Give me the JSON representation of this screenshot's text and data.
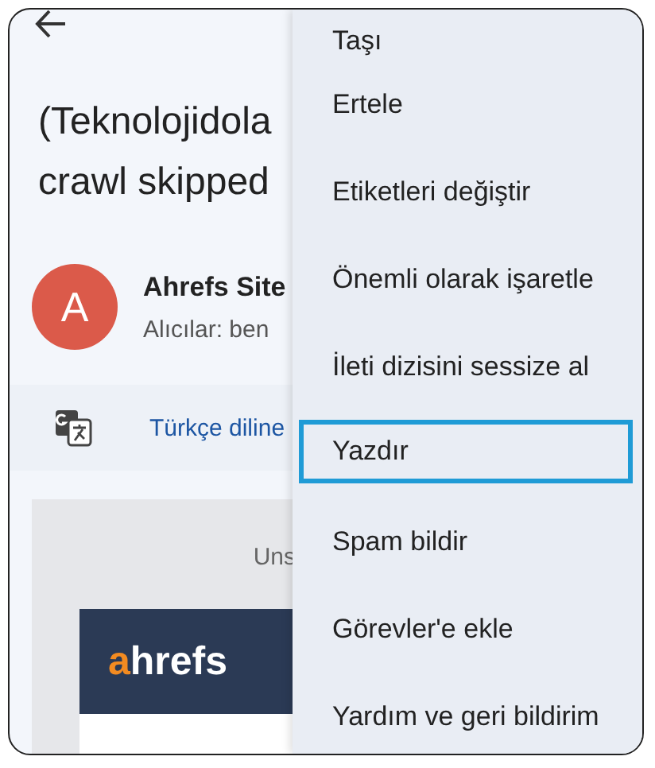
{
  "email": {
    "title_lines": [
      "(Teknolojidola",
      "crawl skipped"
    ],
    "sender": {
      "initial": "A",
      "name": "Ahrefs Site",
      "recipients": "Alıcılar: ben"
    },
    "translate": {
      "label": "Türkçe diline"
    },
    "body": {
      "top_text": "Uns",
      "logo": "ahrefs"
    }
  },
  "menu": {
    "items": [
      {
        "label": "Taşı",
        "selected": false
      },
      {
        "label": "Ertele",
        "selected": false
      },
      {
        "label": "Etiketleri değiştir",
        "selected": false
      },
      {
        "label": "Önemli olarak işaretle",
        "selected": false
      },
      {
        "label": "İleti dizisini sessize al",
        "selected": false
      },
      {
        "label": "Yazdır",
        "selected": true
      },
      {
        "label": "Spam bildir",
        "selected": false
      },
      {
        "label": "Görevler'e ekle",
        "selected": false
      },
      {
        "label": "Yardım ve geri bildirim",
        "selected": false
      }
    ]
  }
}
